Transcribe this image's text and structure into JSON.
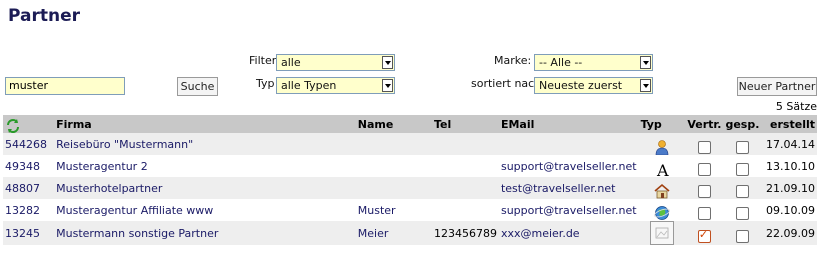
{
  "title": "Partner",
  "filters": {
    "filter_label": "Filter",
    "filter_value": "alle",
    "typ_label": "Typ",
    "typ_value": "alle Typen",
    "marke_label": "Marke:",
    "marke_value": "-- Alle --",
    "sortiert_label": "sortiert nach",
    "sortiert_value": "Neueste zuerst",
    "search_value": "muster",
    "search_button": "Suche",
    "new_partner_button": "Neuer Partner"
  },
  "count_text": "5 Sätze",
  "table": {
    "headers": {
      "firma": "Firma",
      "name": "Name",
      "tel": "Tel",
      "email": "EMail",
      "typ": "Typ",
      "vertr": "Vertr.",
      "gesp": "gesp.",
      "erstellt": "erstellt"
    },
    "rows": [
      {
        "id": "544268",
        "firma": "Reisebüro \"Mustermann\"",
        "name": "",
        "tel": "",
        "email": "",
        "typ_icon": "person-icon",
        "vertr": false,
        "gesp": false,
        "erstellt": "17.04.14"
      },
      {
        "id": "49348",
        "firma": "Musteragentur 2",
        "name": "",
        "tel": "",
        "email": "support@travelseller.net",
        "typ_icon": "letter-a-icon",
        "vertr": false,
        "gesp": false,
        "erstellt": "13.10.10"
      },
      {
        "id": "48807",
        "firma": "Musterhotelpartner",
        "name": "",
        "tel": "",
        "email": "test@travelseller.net",
        "typ_icon": "house-icon",
        "vertr": false,
        "gesp": false,
        "erstellt": "21.09.10"
      },
      {
        "id": "13282",
        "firma": "Musteragentur Affiliate www",
        "name": "Muster",
        "tel": "",
        "email": "support@travelseller.net",
        "typ_icon": "globe-icon",
        "vertr": false,
        "gesp": false,
        "erstellt": "09.10.09"
      },
      {
        "id": "13245",
        "firma": "Mustermann sonstige Partner",
        "name": "Meier",
        "tel": "123456789",
        "email": "xxx@meier.de",
        "typ_icon": "image-thumb-icon",
        "vertr": true,
        "gesp": false,
        "erstellt": "22.09.09"
      }
    ]
  }
}
